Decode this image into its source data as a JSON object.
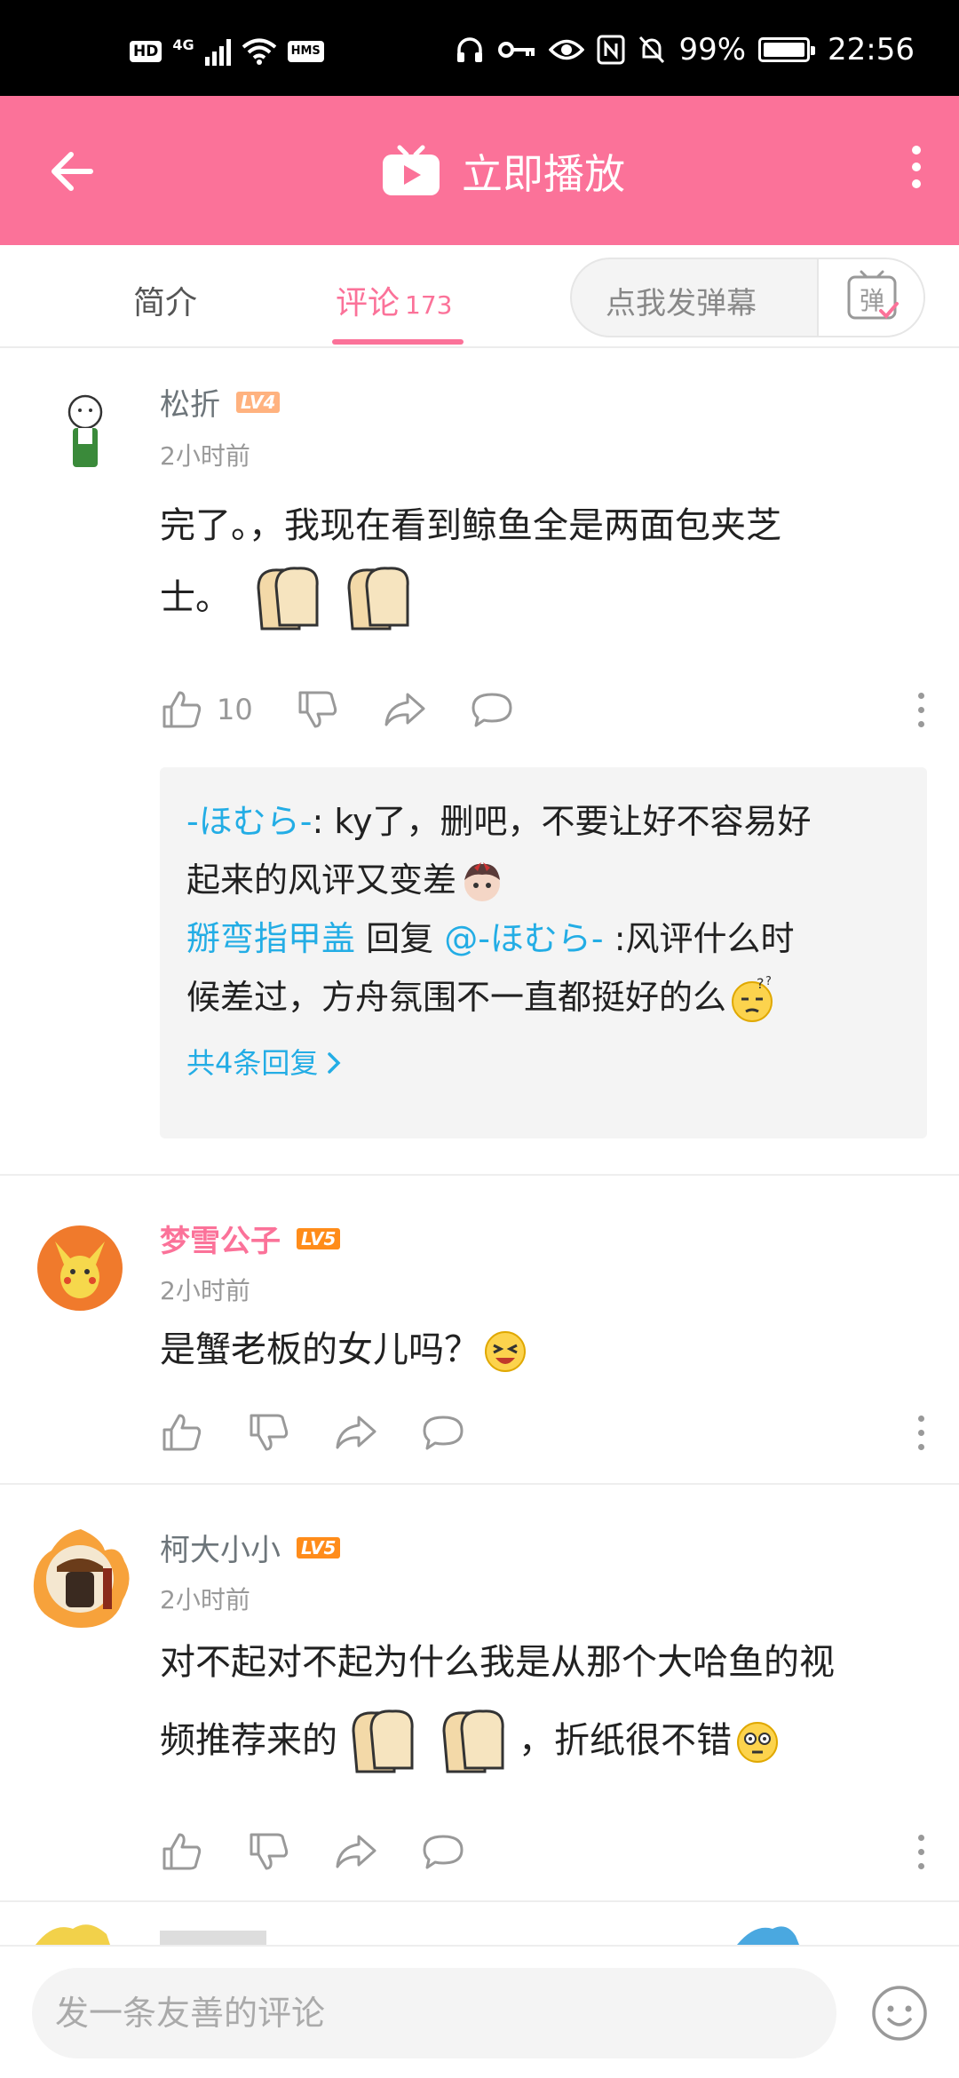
{
  "status_bar": {
    "hd": "HD",
    "net": "4G",
    "hms": "HMS",
    "battery": "99%",
    "time": "22:56"
  },
  "header": {
    "title": "立即播放"
  },
  "tabs": {
    "intro": "简介",
    "comments": "评论",
    "comments_count": "173",
    "danmaku_placeholder": "点我发弹幕",
    "danmaku_btn": "弹"
  },
  "comments": [
    {
      "user": "松折",
      "level": "LV4",
      "time": "2小时前",
      "text_1": "完了。，我现在看到鲸鱼全是两面包夹芝",
      "text_2": "士。",
      "likes": "10",
      "replies": {
        "r1_user": "-ほむら-",
        "r1_text": ": ky了，删吧，不要让好不容易好",
        "r1_text2": "起来的风评又变差",
        "r2_user": "掰弯指甲盖",
        "r2_reply": "回复",
        "r2_target": "@-ほむら-",
        "r2_text": " :风评什么时",
        "r2_text2": "候差过，方舟氛围不一直都挺好的么",
        "more": "共4条回复"
      }
    },
    {
      "user": "梦雪公子",
      "level": "LV5",
      "time": "2小时前",
      "text_1": "是蟹老板的女儿吗？"
    },
    {
      "user": "柯大小小",
      "level": "LV5",
      "time": "2小时前",
      "text_1": "对不起对不起为什么我是从那个大哈鱼的视",
      "text_2": "频推荐来的",
      "text_3": "，折纸很不错"
    }
  ],
  "input": {
    "placeholder": "发一条友善的评论"
  },
  "colors": {
    "brand": "#fb7299",
    "link": "#23ade5"
  }
}
